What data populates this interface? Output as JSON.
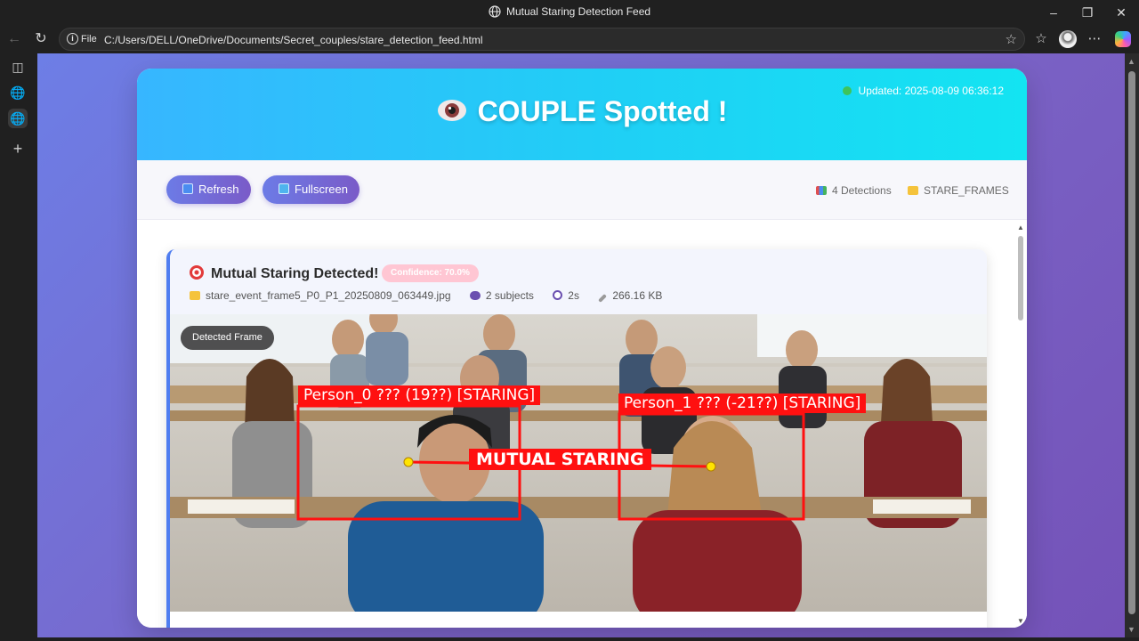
{
  "window": {
    "title": "Mutual Staring Detection Feed"
  },
  "address": {
    "scheme": "File",
    "url": "C:/Users/DELL/OneDrive/Documents/Secret_couples/stare_detection_feed.html"
  },
  "header": {
    "status_text": "Updated: 2025-08-09 06:36:12",
    "status_color": "#3ec45a",
    "title": "COUPLE Spotted !"
  },
  "toolbar": {
    "refresh_label": "Refresh",
    "fullscreen_label": "Fullscreen",
    "detections_label": "4 Detections",
    "folder_label": "STARE_FRAMES"
  },
  "detection": {
    "title": "Mutual Staring Detected!",
    "confidence": "Confidence: 70.0%",
    "filename": "stare_event_frame5_P0_P1_20250809_063449.jpg",
    "subjects": "2 subjects",
    "duration": "2s",
    "size": "266.16 KB",
    "frame_tag": "Detected Frame",
    "person0_label": "Person_0 ??? (19??) [STARING]",
    "person1_label": "Person_1 ??? (-21??) [STARING]",
    "mutual_label": "MUTUAL STARING"
  },
  "icons": {
    "eye": "eye-icon",
    "refresh": "refresh-icon",
    "fullscreen": "monitor-icon",
    "chart": "bar-chart-icon",
    "folder": "folder-icon",
    "target": "target-icon",
    "subjects": "people-icon",
    "timer": "stopwatch-icon",
    "size": "paperclip-icon"
  },
  "colors": {
    "accent_gradient_start": "#6c7be6",
    "accent_gradient_end": "#7a5bc8",
    "header_start": "#37b6ff",
    "header_end": "#13e4f2",
    "detection_box": "#ff1010",
    "badge_bg": "#ffc6d3"
  }
}
